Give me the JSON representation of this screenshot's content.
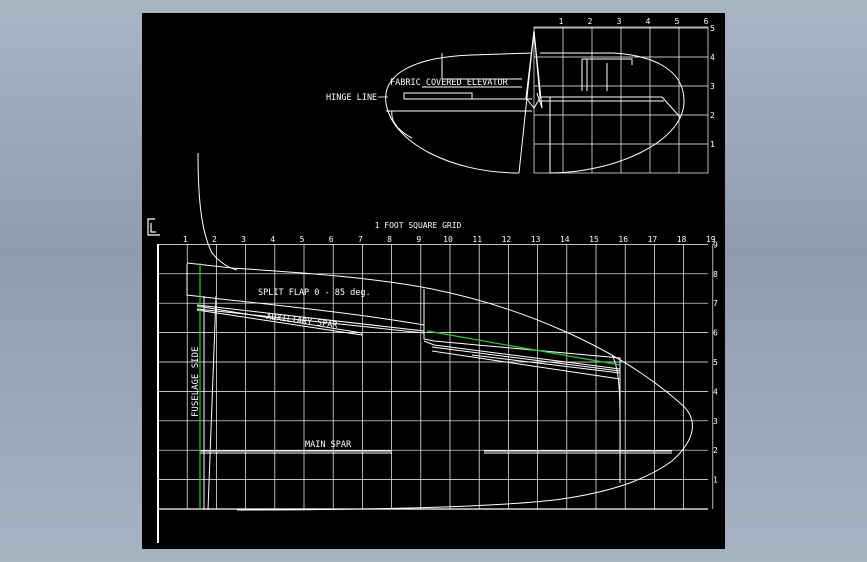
{
  "main_grid": {
    "title": "1 FOOT SQUARE GRID",
    "x_labels": [
      "1",
      "2",
      "3",
      "4",
      "5",
      "6",
      "7",
      "8",
      "9",
      "10",
      "11",
      "12",
      "13",
      "14",
      "15",
      "16",
      "17",
      "18",
      "19"
    ],
    "y_labels": [
      "1",
      "2",
      "3",
      "4",
      "5",
      "6",
      "7",
      "8",
      "9"
    ]
  },
  "tail_grid": {
    "x_labels": [
      "1",
      "2",
      "3",
      "4",
      "5",
      "6"
    ],
    "y_labels": [
      "1",
      "2",
      "3",
      "4",
      "5"
    ]
  },
  "labels": {
    "split_flap": "SPLIT FLAP 0 - 85 deg.",
    "auxiliary_spar": "AUXILIARY SPAR",
    "fuselage_side": "FUSELAGE SIDE",
    "main_spar": "MAIN SPAR",
    "hinge_line": "HINGE LINE",
    "fabric_elevator": "FABRIC COVERED ELEVATOR"
  },
  "colors": {
    "background": "#000000",
    "lines": "#ffffff",
    "accent": "#22cc33"
  }
}
